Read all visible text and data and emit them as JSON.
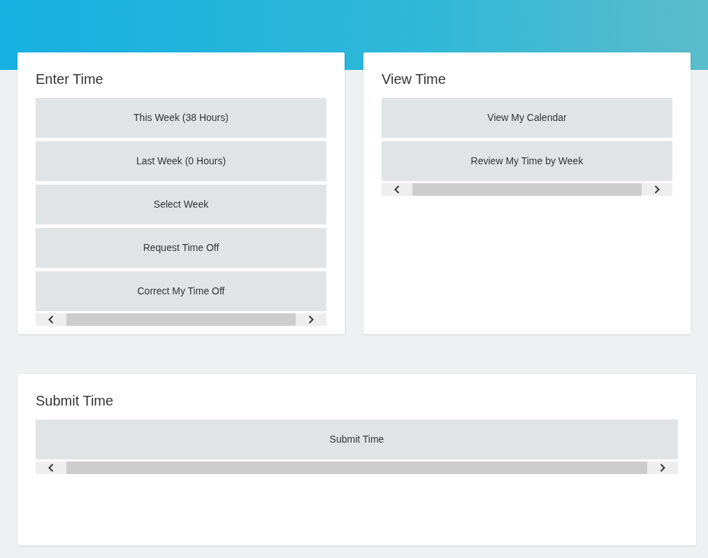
{
  "panels": [
    {
      "title": "Enter Time",
      "buttons": [
        "This Week (38 Hours)",
        "Last Week (0 Hours)",
        "Select Week",
        "Request Time Off",
        "Correct My Time Off"
      ]
    },
    {
      "title": "View Time",
      "buttons": [
        "View My Calendar",
        "Review My Time by Week"
      ]
    }
  ],
  "submit_panel": {
    "title": "Submit Time",
    "buttons": [
      "Submit Time"
    ]
  }
}
